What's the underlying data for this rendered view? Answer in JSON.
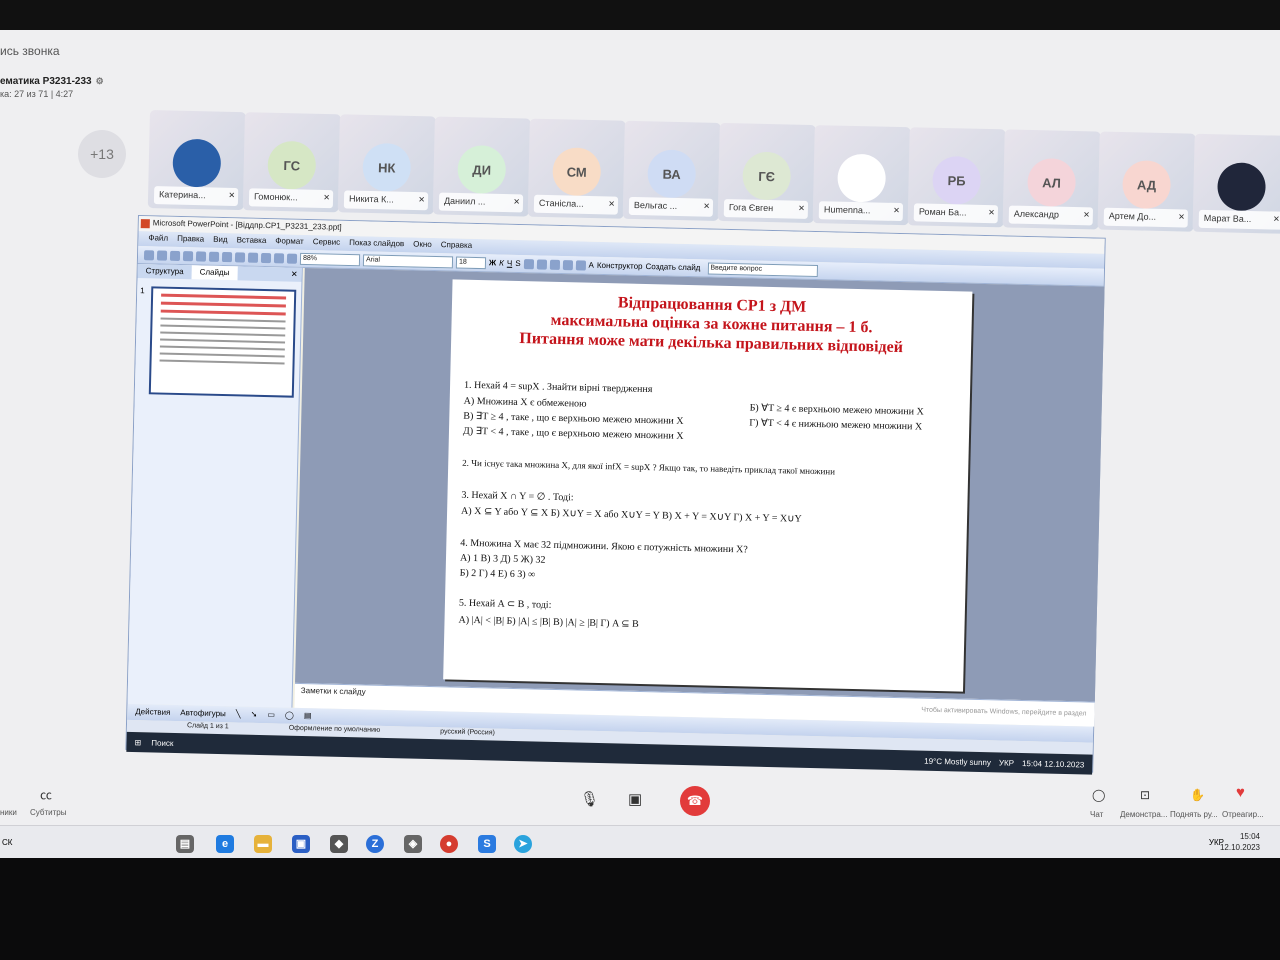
{
  "call": {
    "header_title": "ись звонка",
    "course_title": "ематика P3231-233",
    "course_sub": "ка: 27 из 71 | 4:27",
    "more_participants": "+13",
    "participants": [
      {
        "initials": "",
        "name": "Катерина...",
        "color": "#2a5fa8"
      },
      {
        "initials": "ГС",
        "name": "Гомонюк...",
        "color": "#d6e7c5"
      },
      {
        "initials": "НК",
        "name": "Никита К...",
        "color": "#cfe0f5"
      },
      {
        "initials": "ДИ",
        "name": "Даниил ...",
        "color": "#d6f0d8"
      },
      {
        "initials": "СМ",
        "name": "Станісла...",
        "color": "#f8dcc6"
      },
      {
        "initials": "ВА",
        "name": "Вельгас ...",
        "color": "#cfdcf4"
      },
      {
        "initials": "ГЄ",
        "name": "Гога Євген",
        "color": "#dde8d3"
      },
      {
        "initials": "",
        "name": "Humenna...",
        "color": "#ffffff"
      },
      {
        "initials": "РБ",
        "name": "Роман Ба...",
        "color": "#dcd4f4"
      },
      {
        "initials": "АЛ",
        "name": "Александр",
        "color": "#f4d4da"
      },
      {
        "initials": "АД",
        "name": "Артем До...",
        "color": "#f8d6d0"
      },
      {
        "initials": "",
        "name": "Марат Ва...",
        "color": "#20263a"
      }
    ],
    "controls": {
      "subtitles_label": "Субтитры",
      "left_label": "ники",
      "chat_label": "Чат",
      "demo_label": "Демонстра...",
      "raise_label": "Поднять ру...",
      "react_label": "Отреагир..."
    }
  },
  "ppt": {
    "window_title": "Microsoft PowerPoint - [Віддпр.СР1_P3231_233.ppt]",
    "menu": [
      "Файл",
      "Правка",
      "Вид",
      "Вставка",
      "Формат",
      "Сервис",
      "Показ слайдов",
      "Окно",
      "Справка"
    ],
    "zoom": "88%",
    "font": "Arial",
    "font_size": "18",
    "help_placeholder": "Введите вопрос",
    "designer_label": "Конструктор",
    "new_slide_label": "Создать слайд",
    "tabs": [
      "Структура",
      "Слайды"
    ],
    "thumb_number": "1",
    "notes_placeholder": "Заметки к слайду",
    "activation_note": "Чтобы активировать Windows, перейдите в раздел",
    "actions_label": "Действия",
    "autoshapes_label": "Автофигуры",
    "status": {
      "slide": "Слайд 1 из 1",
      "design": "Оформление по умолчанию",
      "language": "русский (Россия)"
    },
    "taskbar": {
      "search": "Поиск",
      "weather": "19°C  Mostly sunny",
      "lang": "УКР",
      "time": "15:04",
      "date": "12.10.2023"
    }
  },
  "slide": {
    "title_lines": [
      "Відпрацювання СР1 з ДМ",
      "максимальна оцінка за кожне питання – 1 б.",
      "Питання може мати декілька правильних відповідей"
    ],
    "q1": "1. Нехай  4 = supX . Знайти вірні твердження",
    "q1a": "А) Множина X є обмеженою",
    "q1b": "Б)  ∀T ≥ 4  є верхньою межею множини X",
    "q1c": "В) ∃T ≥ 4 , таке , що є верхньою межею множини X",
    "q1d": "Г) ∀T < 4  є нижньою межею множини X",
    "q1e": "Д) ∃T < 4 , таке , що є верхньою межею множини X",
    "q2": "2. Чи існує така множина X, для якої  infX = supX ? Якщо так, то наведіть приклад такої множини",
    "q3": "3. Нехай  X ∩ Y = ∅ . Тоді:",
    "q3a": "А) X ⊆ Y  або  Y ⊆ X   Б) X∪Y = X  або  X∪Y = Y   В) X + Y = X∪Y   Г) X + Y = X∪Y",
    "q4": "4. Множина X має 32 підмножини. Якою є потужність множини X?",
    "q4a": "А) 1    В) 3    Д) 5   Ж) 32",
    "q4b": "Б) 2    Г) 4    Е) 6   З) ∞",
    "q5": "5. Нехай  A ⊂ B , тоді:",
    "q5a": "А) |A| < |B|   Б) |A| ≤ |B|   В) |A| ≥ |B|   Г) A ⊆ B"
  },
  "host": {
    "lang": "УКР",
    "time": "15:04",
    "date": "12.10.2023",
    "left_text": "СК"
  }
}
